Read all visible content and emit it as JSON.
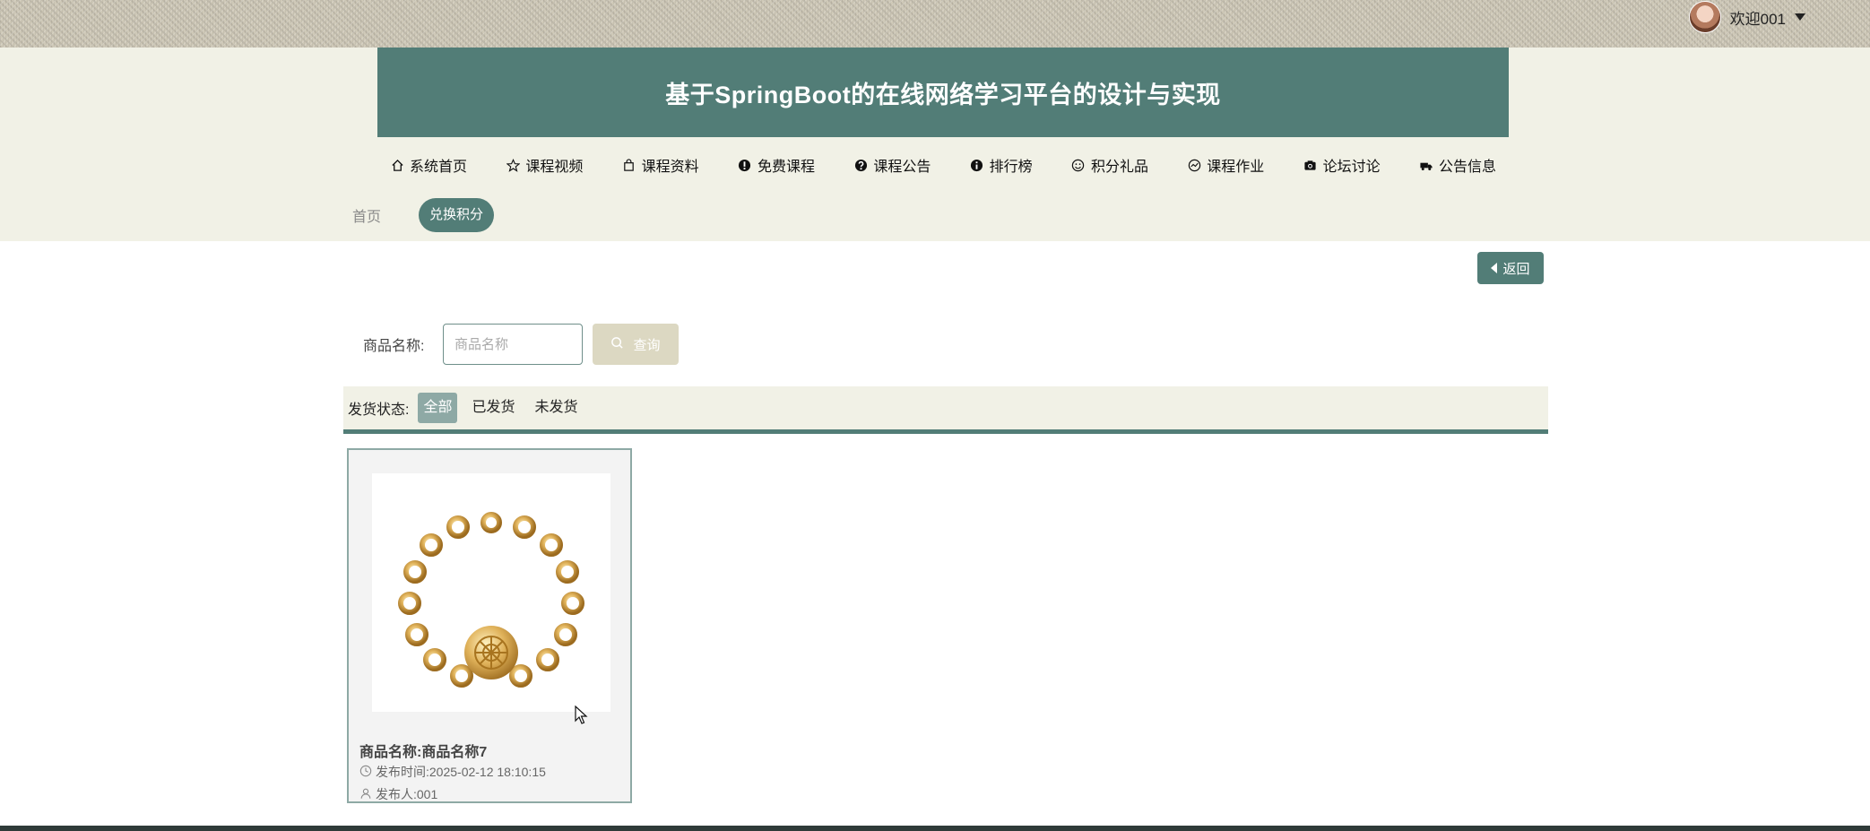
{
  "topbar": {
    "welcome": "欢迎001"
  },
  "header": {
    "title": "基于SpringBoot的在线网络学习平台的设计与实现"
  },
  "nav": [
    {
      "label": "系统首页",
      "icon": "home-icon"
    },
    {
      "label": "课程视频",
      "icon": "star-icon"
    },
    {
      "label": "课程资料",
      "icon": "bag-icon"
    },
    {
      "label": "免费课程",
      "icon": "exclamation-icon"
    },
    {
      "label": "课程公告",
      "icon": "question-icon"
    },
    {
      "label": "排行榜",
      "icon": "info-icon"
    },
    {
      "label": "积分礼品",
      "icon": "smile-icon"
    },
    {
      "label": "课程作业",
      "icon": "chart-circle-icon"
    },
    {
      "label": "论坛讨论",
      "icon": "camera-icon"
    },
    {
      "label": "公告信息",
      "icon": "truck-icon"
    }
  ],
  "breadcrumb": {
    "home": "首页",
    "current": "兑换积分"
  },
  "back_label": "返回",
  "search": {
    "label": "商品名称:",
    "placeholder": "商品名称",
    "button": "查询"
  },
  "filter": {
    "label": "发货状态:",
    "options": [
      "全部",
      "已发货",
      "未发货"
    ],
    "selected": "全部"
  },
  "items": [
    {
      "title": "商品名称:商品名称7",
      "time": "发布时间:2025-02-12 18:10:15",
      "publisher": "发布人:001"
    }
  ],
  "colors": {
    "primary": "#527d77",
    "cream": "#f1f1e6",
    "accent_soft": "#8ea9a5",
    "search_btn": "#dcd8c2"
  }
}
